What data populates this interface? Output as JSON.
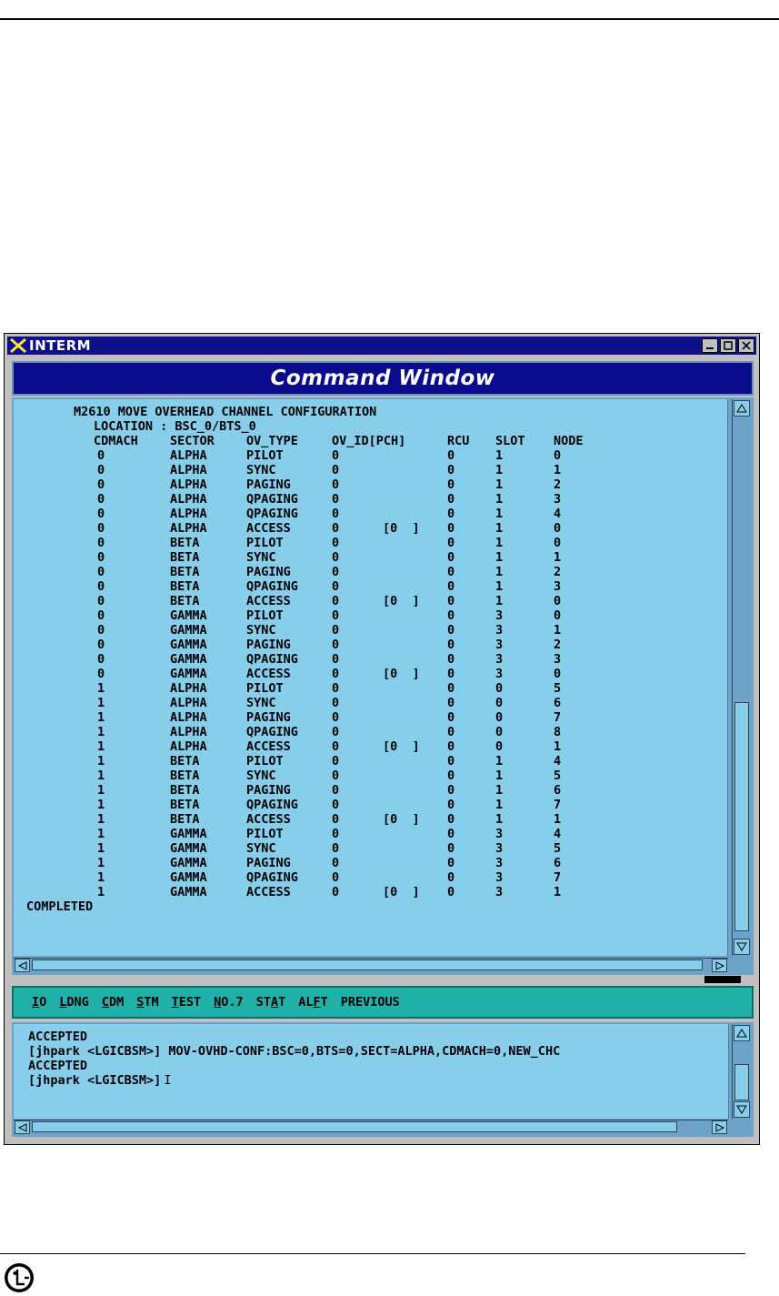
{
  "window": {
    "title": "INTERM",
    "minimize_glyph": "▁",
    "maximize_glyph": "□",
    "close_glyph": "✕"
  },
  "command_window": {
    "title": "Command Window"
  },
  "output": {
    "header_line": "M2610 MOVE OVERHEAD CHANNEL CONFIGURATION",
    "location_line": "LOCATION : BSC_0/BTS_0",
    "columns": [
      "CDMACH",
      "SECTOR",
      "OV_TYPE",
      "OV_ID[PCH]",
      "RCU",
      "SLOT",
      "NODE"
    ],
    "rows": [
      {
        "cdmach": "0",
        "sector": "ALPHA",
        "ov_type": "PILOT",
        "ov_id": "0",
        "pch": "",
        "rcu": "0",
        "slot": "1",
        "node": "0"
      },
      {
        "cdmach": "0",
        "sector": "ALPHA",
        "ov_type": "SYNC",
        "ov_id": "0",
        "pch": "",
        "rcu": "0",
        "slot": "1",
        "node": "1"
      },
      {
        "cdmach": "0",
        "sector": "ALPHA",
        "ov_type": "PAGING",
        "ov_id": "0",
        "pch": "",
        "rcu": "0",
        "slot": "1",
        "node": "2"
      },
      {
        "cdmach": "0",
        "sector": "ALPHA",
        "ov_type": "QPAGING",
        "ov_id": "0",
        "pch": "",
        "rcu": "0",
        "slot": "1",
        "node": "3"
      },
      {
        "cdmach": "0",
        "sector": "ALPHA",
        "ov_type": "QPAGING",
        "ov_id": "0",
        "pch": "",
        "rcu": "0",
        "slot": "1",
        "node": "4"
      },
      {
        "cdmach": "0",
        "sector": "ALPHA",
        "ov_type": "ACCESS",
        "ov_id": "0",
        "pch": "[0  ]",
        "rcu": "0",
        "slot": "1",
        "node": "0"
      },
      {
        "cdmach": "0",
        "sector": "BETA",
        "ov_type": "PILOT",
        "ov_id": "0",
        "pch": "",
        "rcu": "0",
        "slot": "1",
        "node": "0"
      },
      {
        "cdmach": "0",
        "sector": "BETA",
        "ov_type": "SYNC",
        "ov_id": "0",
        "pch": "",
        "rcu": "0",
        "slot": "1",
        "node": "1"
      },
      {
        "cdmach": "0",
        "sector": "BETA",
        "ov_type": "PAGING",
        "ov_id": "0",
        "pch": "",
        "rcu": "0",
        "slot": "1",
        "node": "2"
      },
      {
        "cdmach": "0",
        "sector": "BETA",
        "ov_type": "QPAGING",
        "ov_id": "0",
        "pch": "",
        "rcu": "0",
        "slot": "1",
        "node": "3"
      },
      {
        "cdmach": "0",
        "sector": "BETA",
        "ov_type": "ACCESS",
        "ov_id": "0",
        "pch": "[0  ]",
        "rcu": "0",
        "slot": "1",
        "node": "0"
      },
      {
        "cdmach": "0",
        "sector": "GAMMA",
        "ov_type": "PILOT",
        "ov_id": "0",
        "pch": "",
        "rcu": "0",
        "slot": "3",
        "node": "0"
      },
      {
        "cdmach": "0",
        "sector": "GAMMA",
        "ov_type": "SYNC",
        "ov_id": "0",
        "pch": "",
        "rcu": "0",
        "slot": "3",
        "node": "1"
      },
      {
        "cdmach": "0",
        "sector": "GAMMA",
        "ov_type": "PAGING",
        "ov_id": "0",
        "pch": "",
        "rcu": "0",
        "slot": "3",
        "node": "2"
      },
      {
        "cdmach": "0",
        "sector": "GAMMA",
        "ov_type": "QPAGING",
        "ov_id": "0",
        "pch": "",
        "rcu": "0",
        "slot": "3",
        "node": "3"
      },
      {
        "cdmach": "0",
        "sector": "GAMMA",
        "ov_type": "ACCESS",
        "ov_id": "0",
        "pch": "[0  ]",
        "rcu": "0",
        "slot": "3",
        "node": "0"
      },
      {
        "cdmach": "1",
        "sector": "ALPHA",
        "ov_type": "PILOT",
        "ov_id": "0",
        "pch": "",
        "rcu": "0",
        "slot": "0",
        "node": "5"
      },
      {
        "cdmach": "1",
        "sector": "ALPHA",
        "ov_type": "SYNC",
        "ov_id": "0",
        "pch": "",
        "rcu": "0",
        "slot": "0",
        "node": "6"
      },
      {
        "cdmach": "1",
        "sector": "ALPHA",
        "ov_type": "PAGING",
        "ov_id": "0",
        "pch": "",
        "rcu": "0",
        "slot": "0",
        "node": "7"
      },
      {
        "cdmach": "1",
        "sector": "ALPHA",
        "ov_type": "QPAGING",
        "ov_id": "0",
        "pch": "",
        "rcu": "0",
        "slot": "0",
        "node": "8"
      },
      {
        "cdmach": "1",
        "sector": "ALPHA",
        "ov_type": "ACCESS",
        "ov_id": "0",
        "pch": "[0  ]",
        "rcu": "0",
        "slot": "0",
        "node": "1"
      },
      {
        "cdmach": "1",
        "sector": "BETA",
        "ov_type": "PILOT",
        "ov_id": "0",
        "pch": "",
        "rcu": "0",
        "slot": "1",
        "node": "4"
      },
      {
        "cdmach": "1",
        "sector": "BETA",
        "ov_type": "SYNC",
        "ov_id": "0",
        "pch": "",
        "rcu": "0",
        "slot": "1",
        "node": "5"
      },
      {
        "cdmach": "1",
        "sector": "BETA",
        "ov_type": "PAGING",
        "ov_id": "0",
        "pch": "",
        "rcu": "0",
        "slot": "1",
        "node": "6"
      },
      {
        "cdmach": "1",
        "sector": "BETA",
        "ov_type": "QPAGING",
        "ov_id": "0",
        "pch": "",
        "rcu": "0",
        "slot": "1",
        "node": "7"
      },
      {
        "cdmach": "1",
        "sector": "BETA",
        "ov_type": "ACCESS",
        "ov_id": "0",
        "pch": "[0  ]",
        "rcu": "0",
        "slot": "1",
        "node": "1"
      },
      {
        "cdmach": "1",
        "sector": "GAMMA",
        "ov_type": "PILOT",
        "ov_id": "0",
        "pch": "",
        "rcu": "0",
        "slot": "3",
        "node": "4"
      },
      {
        "cdmach": "1",
        "sector": "GAMMA",
        "ov_type": "SYNC",
        "ov_id": "0",
        "pch": "",
        "rcu": "0",
        "slot": "3",
        "node": "5"
      },
      {
        "cdmach": "1",
        "sector": "GAMMA",
        "ov_type": "PAGING",
        "ov_id": "0",
        "pch": "",
        "rcu": "0",
        "slot": "3",
        "node": "6"
      },
      {
        "cdmach": "1",
        "sector": "GAMMA",
        "ov_type": "QPAGING",
        "ov_id": "0",
        "pch": "",
        "rcu": "0",
        "slot": "3",
        "node": "7"
      },
      {
        "cdmach": "1",
        "sector": "GAMMA",
        "ov_type": "ACCESS",
        "ov_id": "0",
        "pch": "[0  ]",
        "rcu": "0",
        "slot": "3",
        "node": "1"
      }
    ],
    "footer_line": "COMPLETED"
  },
  "menu": {
    "items": [
      {
        "pre": "",
        "u": "I",
        "post": "O"
      },
      {
        "pre": "",
        "u": "L",
        "post": "DNG"
      },
      {
        "pre": "",
        "u": "C",
        "post": "DM"
      },
      {
        "pre": "",
        "u": "S",
        "post": "TM"
      },
      {
        "pre": "",
        "u": "T",
        "post": "EST"
      },
      {
        "pre": "",
        "u": "N",
        "post": "O.7"
      },
      {
        "pre": "ST",
        "u": "A",
        "post": "T"
      },
      {
        "pre": "AL",
        "u": "F",
        "post": "T"
      },
      {
        "pre": "PREVIOUS",
        "u": "",
        "post": ""
      }
    ]
  },
  "input": {
    "lines": [
      "ACCEPTED",
      "[jhpark <LGICBSM>] MOV-OVHD-CONF:BSC=0,BTS=0,SECT=ALPHA,CDMACH=0,NEW_CHC",
      "ACCEPTED",
      "[jhpark <LGICBSM>]"
    ],
    "caret": "I"
  },
  "colors": {
    "terminal_bg": "#87ceeb",
    "title_bar": "#0f0f8a",
    "menu_bar": "#20b2aa"
  },
  "icons": {
    "title_icon": "x-logo-icon",
    "footer_logo": "lg-logo-icon"
  }
}
